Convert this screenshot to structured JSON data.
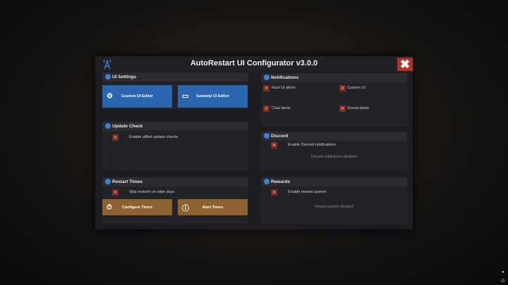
{
  "window": {
    "title": "AutoRestart UI Configurator v3.0.0",
    "close_icon": "close-x-icon"
  },
  "colors": {
    "accent_blue": "#2b65b0",
    "accent_brown": "#8d6230",
    "close_red": "#b3302b",
    "disabled_red": "#7a2a24"
  },
  "ui_settings": {
    "header": "UI Settings",
    "custom_editor": "Custom UI Editor",
    "gametip_editor": "Gametip UI Editor"
  },
  "update_check": {
    "header": "Update Check",
    "option": "Enable uMod update checks",
    "enabled": false
  },
  "restart_times": {
    "header": "Restart Times",
    "option": "Skip restarts on wipe days",
    "enabled": false,
    "configure": "Configure Times",
    "alert": "Alert Times"
  },
  "notifications": {
    "header": "Notifications",
    "items": [
      {
        "label": "Rust UI alerts",
        "enabled": false
      },
      {
        "label": "Custom UI",
        "enabled": false
      },
      {
        "label": "Chat alerts",
        "enabled": false
      },
      {
        "label": "Sound alerts",
        "enabled": false
      }
    ]
  },
  "discord": {
    "header": "Discord",
    "option": "Enable Discord notifications",
    "enabled": false,
    "status": "Discord notifications disabled"
  },
  "rewards": {
    "header": "Rewards",
    "option": "Enable reward system",
    "enabled": false,
    "status": "Reward system disabled"
  }
}
